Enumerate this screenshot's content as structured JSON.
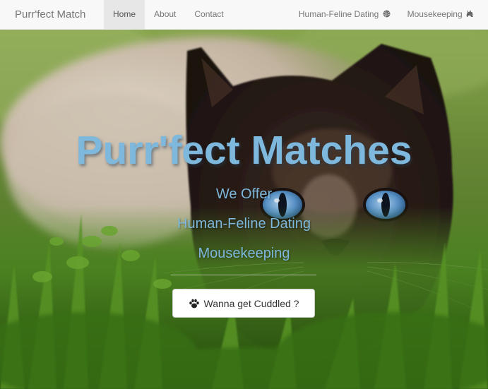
{
  "navbar": {
    "brand": "Purr'fect Match",
    "left_items": [
      {
        "label": "Home",
        "active": true
      },
      {
        "label": "About",
        "active": false
      },
      {
        "label": "Contact",
        "active": false
      }
    ],
    "right_items": [
      {
        "label": "Human-Feline Dating",
        "icon": "yarn-ball-icon"
      },
      {
        "label": "Mousekeeping",
        "icon": "cat-silhouette-icon"
      }
    ]
  },
  "hero": {
    "title": "Purr'fect Matches",
    "lines": [
      "We Offer",
      "Human-Feline Dating",
      "Mousekeeping"
    ],
    "cta_label": "Wanna get Cuddled ?",
    "cta_icon": "paw-icon",
    "text_color": "#7eb8dd"
  },
  "colors": {
    "navbar_bg": "#f8f8f8",
    "nav_active_bg": "#e7e7e7",
    "nav_text": "#777777",
    "accent": "#7eb8dd"
  }
}
